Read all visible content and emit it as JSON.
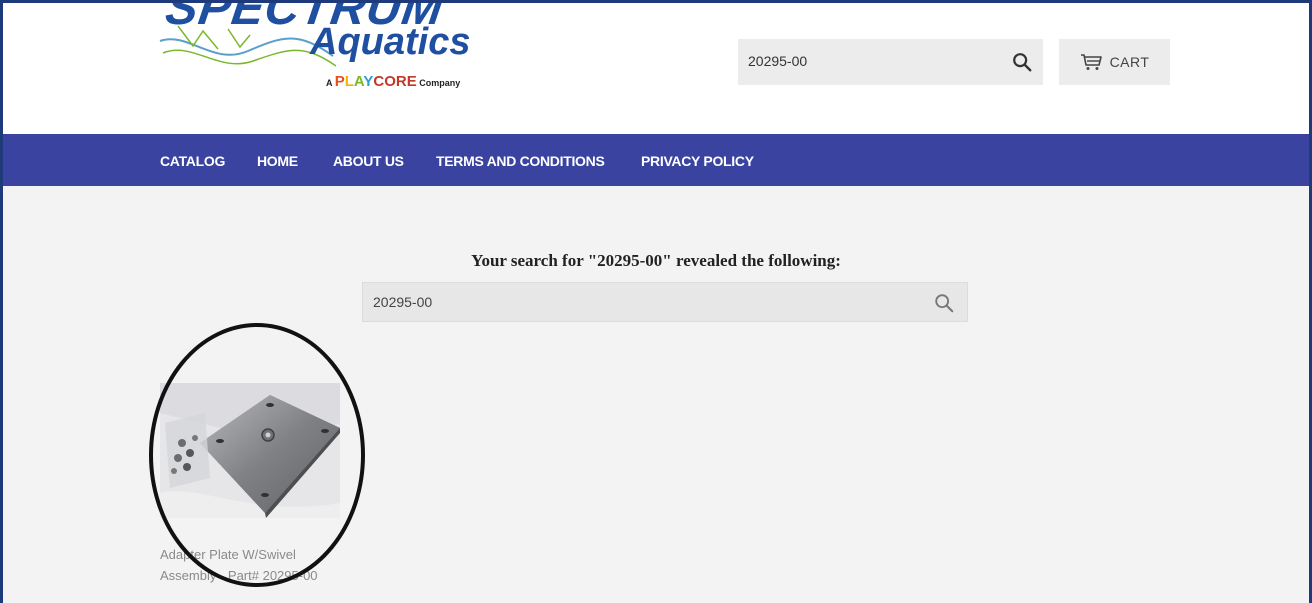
{
  "header": {
    "logo": {
      "wordmark_top": "SPECTRUM",
      "wordmark_bottom": "Aquatics",
      "tagline_prefix": "A",
      "tagline_brand_p": "P",
      "tagline_brand_l": "L",
      "tagline_brand_a": "A",
      "tagline_brand_y": "Y",
      "tagline_brand_core": "CORE",
      "tagline_suffix": "Company"
    },
    "search": {
      "value": "20295-00",
      "icon": "search-icon"
    },
    "cart": {
      "label": "CART",
      "icon": "cart-icon"
    }
  },
  "nav": {
    "items": [
      {
        "label": "CATALOG"
      },
      {
        "label": "HOME"
      },
      {
        "label": "ABOUT US"
      },
      {
        "label": "TERMS AND CONDITIONS"
      },
      {
        "label": "PRIVACY POLICY"
      }
    ],
    "color": "#3a44a0"
  },
  "results": {
    "heading": "Your search for \"20295-00\" revealed the following:",
    "search": {
      "value": "20295-00",
      "icon": "search-icon"
    },
    "products": [
      {
        "title": "Adapter Plate W/Swivel Assembly - Part# 20295-00"
      }
    ]
  },
  "colors": {
    "brand_blue": "#1f4fa0",
    "nav": "#3a44a0",
    "frame": "#1f3a7a"
  }
}
